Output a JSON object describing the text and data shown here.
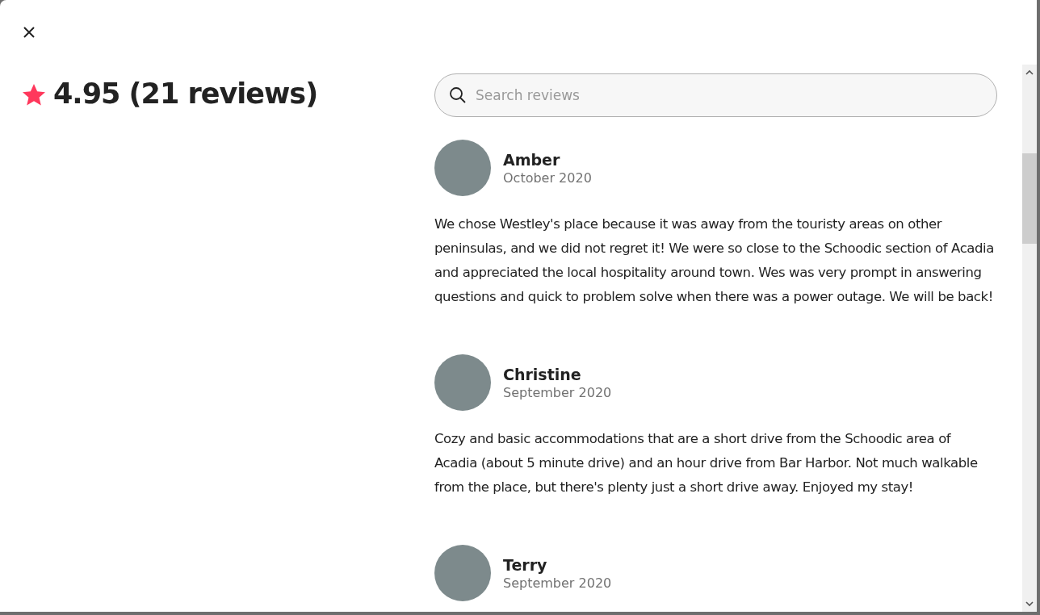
{
  "rating": {
    "score": "4.95 (21 reviews)"
  },
  "search": {
    "placeholder": "Search reviews"
  },
  "reviews": [
    {
      "name": "Amber",
      "date": "October 2020",
      "text": "We chose Westley's place because it was away from the touristy areas on other peninsulas, and we did not regret it! We were so close to the Schoodic section of Acadia and appreciated the local hospitality around town. Wes was very prompt in answering questions and quick to problem solve when there was a power outage. We will be back!"
    },
    {
      "name": "Christine",
      "date": "September 2020",
      "text": "Cozy and basic accommodations that are a short drive from the Schoodic area of Acadia (about 5 minute drive) and an hour drive from Bar Harbor. Not much walkable from the place, but there's plenty just a short drive away. Enjoyed my stay!"
    },
    {
      "name": "Terry",
      "date": "September 2020"
    }
  ]
}
